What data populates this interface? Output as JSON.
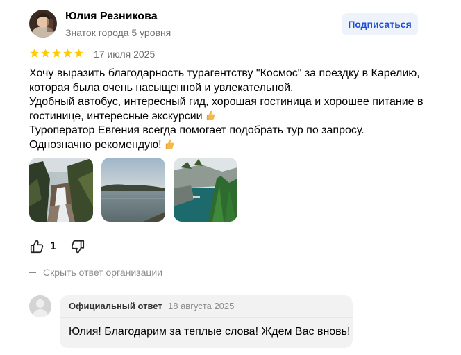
{
  "author": {
    "name": "Юлия Резникова",
    "level": "Знаток города 5 уровня",
    "subscribe_label": "Подписаться"
  },
  "review": {
    "rating": 5,
    "rating_max": 5,
    "date": "17 июля 2025",
    "lines": {
      "p1": "Хочу выразить благодарность турагентству \"Космос\" за поездку в Карелию, которая была очень насыщенной и увлекательной.",
      "p2": "Удобный автобус, интересный гид, хорошая гостиница и хорошее питание в гостинице, интересные экскурсии",
      "p3": "Туроператор Евгения всегда помогает подобрать тур по запросу.",
      "p4": "Однозначно рекомендую!"
    },
    "photos": [
      "waterfall-photo",
      "lake-photo",
      "marble-canyon-photo"
    ]
  },
  "reactions": {
    "likes": "1"
  },
  "hide_answer_label": "Скрыть ответ организации",
  "official_answer": {
    "label": "Официальный ответ",
    "date": "18 августа 2025",
    "text": "Юлия! Благодарим за теплые слова! Ждем Вас вновь!"
  },
  "colors": {
    "star": "#ffcc00",
    "accent": "#1d4ed8",
    "muted": "#6f6f6f",
    "answer_bg": "#f2f2f2"
  },
  "icons": [
    "thumb-up-icon",
    "thumb-down-icon",
    "star-icon",
    "thumbs-up-emoji"
  ]
}
